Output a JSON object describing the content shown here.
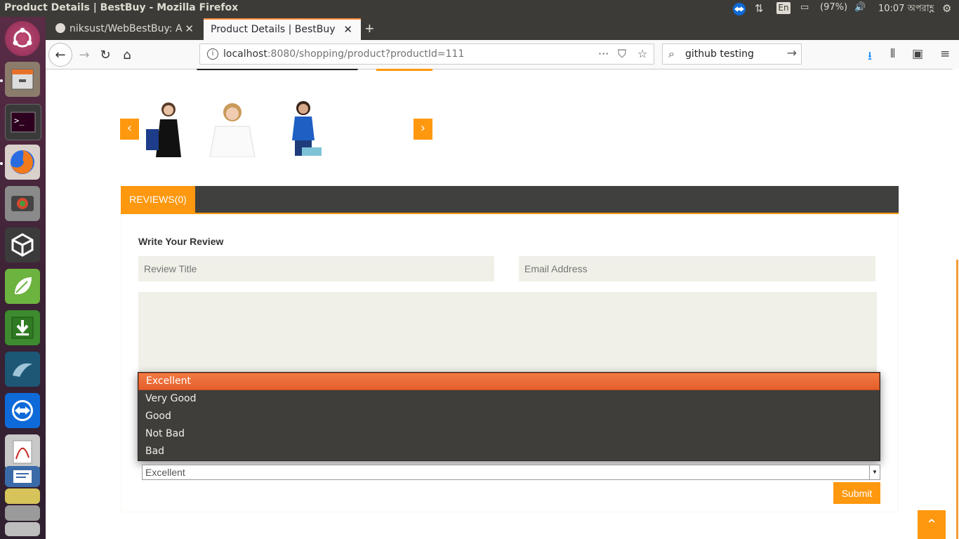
{
  "window": {
    "title": "Product Details | BestBuy - Mozilla Firefox"
  },
  "system": {
    "language": "En",
    "battery": "(97%)",
    "clock": "10:07 অপরাহ্ণ"
  },
  "browser": {
    "tabs": [
      {
        "label": "niksust/WebBestBuy: A"
      },
      {
        "label": "Product Details | BestBuy"
      }
    ],
    "url_host": "localhost",
    "url_path": ":8080/shopping/product?productId=111",
    "search_value": "github testing"
  },
  "page": {
    "carousel": {
      "prev": "‹",
      "next": "›"
    },
    "reviews_tab": "REVIEWS(0)",
    "review_heading": "Write Your Review",
    "title_placeholder": "Review Title",
    "email_placeholder": "Email Address",
    "rating_options": [
      "Excellent",
      "Very Good",
      "Good",
      "Not Bad",
      "Bad"
    ],
    "rating_selected": "Excellent",
    "submit_label": "Submit"
  },
  "colors": {
    "accent": "#fe980f",
    "dark_bar": "#40403e",
    "field_bg": "#f0f0e9"
  }
}
